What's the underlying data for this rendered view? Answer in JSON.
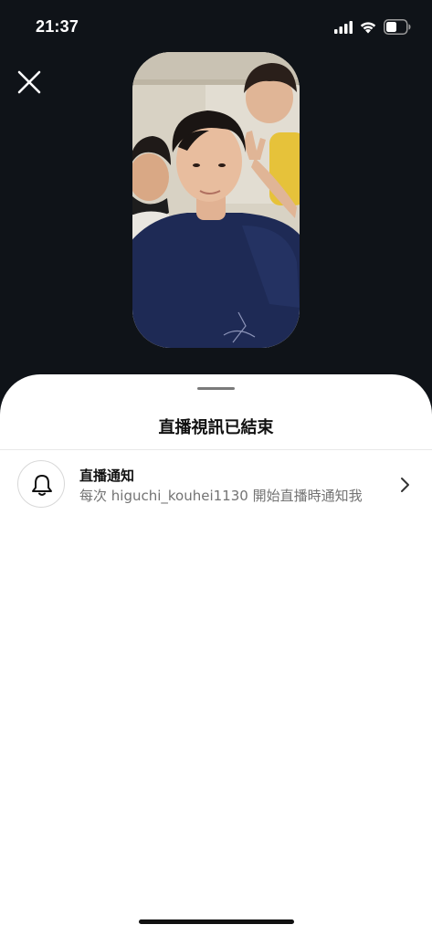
{
  "status_bar": {
    "time": "21:37",
    "signal_icon": "cellular-signal-icon",
    "wifi_icon": "wifi-icon",
    "battery_icon": "battery-icon"
  },
  "header": {
    "close_icon": "close-icon"
  },
  "video_preview": {
    "description_icon": "live-video-thumbnail"
  },
  "sheet": {
    "title": "直播視訊已結束",
    "notification": {
      "icon": "bell-icon",
      "title": "直播通知",
      "subtitle": "每次 higuchi_kouhei1130 開始直播時通知我",
      "chevron_icon": "chevron-right-icon"
    }
  },
  "colors": {
    "background": "#0f1318",
    "sheet": "#ffffff",
    "subtitle_text": "#737373"
  }
}
